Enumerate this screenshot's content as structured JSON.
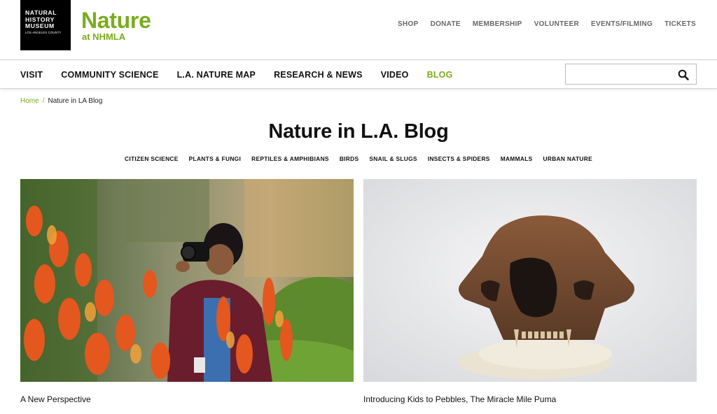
{
  "logo": {
    "line1": "NATURAL",
    "line2": "HISTORY",
    "line3": "MUSEUM",
    "line4": "LOS ANGELES COUNTY"
  },
  "site": {
    "title": "Nature",
    "subtitle": "at NHMLA",
    "brand_color": "#7aac1c"
  },
  "utility_nav": [
    "SHOP",
    "DONATE",
    "MEMBERSHIP",
    "VOLUNTEER",
    "EVENTS/FILMING",
    "TICKETS"
  ],
  "main_nav": [
    {
      "label": "VISIT"
    },
    {
      "label": "COMMUNITY SCIENCE"
    },
    {
      "label": "L.A. NATURE MAP"
    },
    {
      "label": "RESEARCH & NEWS"
    },
    {
      "label": "VIDEO"
    },
    {
      "label": "BLOG",
      "active": true
    }
  ],
  "search": {
    "placeholder": "",
    "icon": "search-icon"
  },
  "breadcrumb": {
    "home": "Home",
    "separator": "/",
    "current": "Nature in LA Blog"
  },
  "page_title": "Nature in L.A. Blog",
  "categories": [
    "CITIZEN SCIENCE",
    "PLANTS & FUNGI",
    "REPTILES & AMPHIBIANS",
    "BIRDS",
    "SNAIL & SLUGS",
    "INSECTS & SPIDERS",
    "MAMMALS",
    "URBAN NATURE"
  ],
  "posts": [
    {
      "title": "A New Perspective"
    },
    {
      "title": "Introducing Kids to Pebbles, The Miracle Mile Puma"
    }
  ]
}
